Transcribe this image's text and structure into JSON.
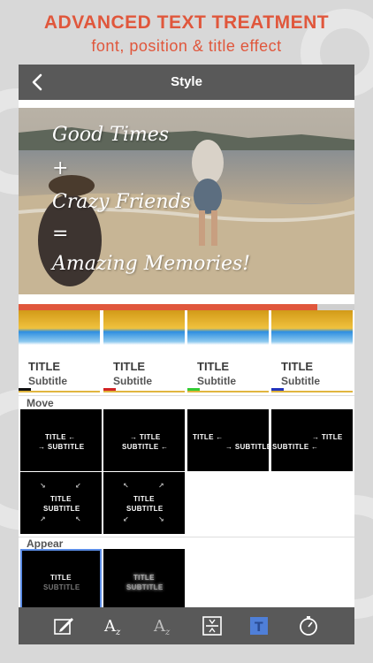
{
  "promo": {
    "title": "ADVANCED TEXT TREATMENT",
    "subtitle": "font, position & title effect"
  },
  "navbar": {
    "title": "Style",
    "back_icon": "chevron-left-icon"
  },
  "preview": {
    "lines": [
      "Good Times",
      "+",
      "Crazy Friends",
      "=",
      "Amazing Memories!"
    ],
    "progress": 0.89
  },
  "presets": [
    {
      "title": "TITLE",
      "subtitle": "Subtitle",
      "swatch": "#111111"
    },
    {
      "title": "TITLE",
      "subtitle": "Subtitle",
      "swatch": "#d22222"
    },
    {
      "title": "TITLE",
      "subtitle": "Subtitle",
      "swatch": "#33cc33"
    },
    {
      "title": "TITLE",
      "subtitle": "Subtitle",
      "swatch": "#2233bb"
    }
  ],
  "move": {
    "label": "Move",
    "tiles": [
      {
        "t1": "TITLE ←",
        "t2": "→ SUBTITLE"
      },
      {
        "t1": "→ TITLE",
        "t2": "SUBTITLE ←"
      },
      {
        "t1": "TITLE ←",
        "t2": "→ SUBTITLE"
      },
      {
        "t1": "→ TITLE",
        "t2": "SUBTITLE ←"
      },
      {
        "t1": "TITLE",
        "t2": "SUBTITLE"
      },
      {
        "t1": "TITLE",
        "t2": "SUBTITLE"
      }
    ]
  },
  "appear": {
    "label": "Appear",
    "tiles": [
      {
        "t1": "TITLE",
        "t2": "SUBTITLE"
      },
      {
        "t1": "TITLE",
        "t2": "SUBTITLE"
      }
    ]
  },
  "toolbar": {
    "items": [
      "edit-text-icon",
      "font-icon",
      "font-style-icon",
      "position-icon",
      "text-effect-icon",
      "timing-icon"
    ],
    "active": "text-effect-icon"
  },
  "colors": {
    "accent": "#e0573c",
    "bar": "#595959",
    "selected": "#5b8ce6"
  }
}
